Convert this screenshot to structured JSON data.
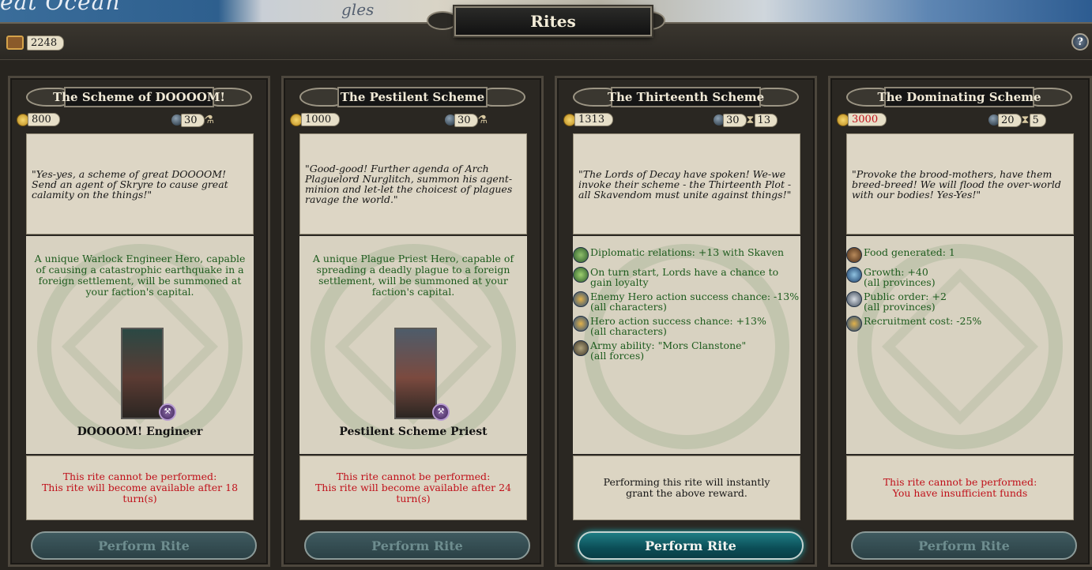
{
  "window": {
    "title": "Rites",
    "map_text": "eat Ocean",
    "map_text2": "gles"
  },
  "treasury": {
    "value": "2248"
  },
  "help": {
    "label": "?"
  },
  "rites": [
    {
      "name": "The Scheme of DOOOOM!",
      "cost": "800",
      "cost_affordable": true,
      "resource": "30",
      "turns": null,
      "quote": "\"Yes-yes, a scheme of great DOOOOM! Send an agent of Skryre to cause great calamity on the things!\"",
      "description": "A unique Warlock Engineer Hero, capable of causing a catastrophic earthquake in a foreign settlement, will be summoned at your faction's capital.",
      "hero_name": "DOOOOM! Engineer",
      "status_line1": "This rite cannot be performed:",
      "status_line2": "This rite will become available after 18 turn(s)",
      "status_ok": false,
      "button": "Perform Rite",
      "button_enabled": false
    },
    {
      "name": "The Pestilent Scheme",
      "cost": "1000",
      "cost_affordable": true,
      "resource": "30",
      "turns": null,
      "quote": "\"Good-good! Further agenda of Arch Plaguelord Nurglitch, summon his agent-minion and let-let the choicest of plagues ravage the world.\"",
      "description": "A unique Plague Priest Hero, capable of spreading a deadly plague to a foreign settlement, will be summoned at your faction's capital.",
      "hero_name": "Pestilent Scheme Priest",
      "status_line1": "This rite cannot be performed:",
      "status_line2": "This rite will become available after 24 turn(s)",
      "status_ok": false,
      "button": "Perform Rite",
      "button_enabled": false
    },
    {
      "name": "The Thirteenth Scheme",
      "cost": "1313",
      "cost_affordable": true,
      "resource": "30",
      "turns": "13",
      "quote": "\"The Lords of Decay have spoken! We-we invoke their scheme - the Thirteenth Plot - all Skavendom must unite against things!\"",
      "effects": [
        {
          "icon": "diplomacy-icon",
          "text": "Diplomatic relations: +13 with Skaven",
          "sub": ""
        },
        {
          "icon": "lord-chance-icon",
          "text": "On turn start, Lords have a chance to gain loyalty",
          "sub": ""
        },
        {
          "icon": "enemy-hero-icon",
          "text": "Enemy Hero action success chance: -13%",
          "sub": "(all characters)"
        },
        {
          "icon": "hero-action-icon",
          "text": "Hero action success chance: +13%",
          "sub": "(all characters)"
        },
        {
          "icon": "army-ability-icon",
          "text": "Army ability: \"Mors Clanstone\"",
          "sub": "(all forces)"
        }
      ],
      "status_line1": "Performing this rite will instantly grant the above reward.",
      "status_line2": "",
      "status_ok": true,
      "button": "Perform Rite",
      "button_enabled": true
    },
    {
      "name": "The Dominating Scheme",
      "cost": "3000",
      "cost_affordable": false,
      "resource": "20",
      "turns": "5",
      "quote": "\"Provoke the brood-mothers, have them breed-breed! We will flood the over-world with our bodies! Yes-Yes!\"",
      "effects": [
        {
          "icon": "food-icon",
          "text": "Food generated: 1",
          "sub": ""
        },
        {
          "icon": "growth-icon",
          "text": "Growth: +40",
          "sub": "(all provinces)"
        },
        {
          "icon": "public-order-icon",
          "text": "Public order: +2",
          "sub": "(all provinces)"
        },
        {
          "icon": "recruitment-cost-icon",
          "text": "Recruitment cost: -25%",
          "sub": ""
        }
      ],
      "status_line1": "This rite cannot be performed:",
      "status_line2": "You have insufficient funds",
      "status_ok": false,
      "button": "Perform Rite",
      "button_enabled": false
    }
  ],
  "colors": {
    "effect_green": "#1d5b1d",
    "warning_red": "#c0101a",
    "button_active": "#1f7d84",
    "parchment": "#ddd6c5"
  }
}
